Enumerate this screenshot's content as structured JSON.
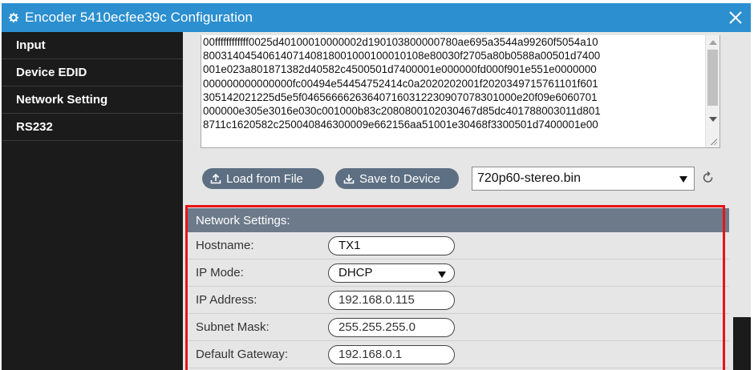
{
  "window": {
    "title": "Encoder 5410ecfee39c Configuration",
    "title_icon": "gear-icon",
    "close_icon": "close-icon",
    "accent_color": "#2b8fd0"
  },
  "sidebar": {
    "items": [
      {
        "label": "Input"
      },
      {
        "label": "Device EDID"
      },
      {
        "label": "Network Setting"
      },
      {
        "label": "RS232"
      }
    ]
  },
  "edid": {
    "lines": [
      "00ffffffffffff0025d40100010000002d190103800000780ae695a3544a99260f5054a10",
      "8003140454061407140818001000100010108e80030f2705a80b0588a00501d7400",
      "001e023a801871382d40582c4500501d7400001e000000fd000f901e551e0000000",
      "000000000000000fc00494e54454752414c0a2020202001f2020349715761101f601",
      "305142021225d5e5f046566662636407160312230907078301000e20f09e6060701",
      "000000e305e3016e030c001000b83c2080800102030467d85dc401788003011d801",
      "8711c1620582c250040846300009e662156aa51001e30468f3300501d7400001e00"
    ],
    "load_button": "Load from File",
    "save_button": "Save to Device",
    "selected_file": "720p60-stereo.bin",
    "refresh_icon": "refresh-icon"
  },
  "network": {
    "header": "Network Settings:",
    "hostname_label": "Hostname:",
    "hostname_value": "TX1",
    "ip_mode_label": "IP Mode:",
    "ip_mode_value": "DHCP",
    "ip_address_label": "IP Address:",
    "ip_address_value": "192.168.0.115",
    "subnet_label": "Subnet Mask:",
    "subnet_value": "255.255.255.0",
    "gateway_label": "Default Gateway:",
    "gateway_value": "192.168.0.1"
  },
  "annotation_color": "#e81414"
}
